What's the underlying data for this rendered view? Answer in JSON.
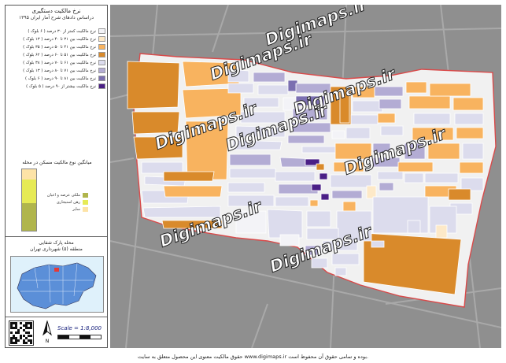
{
  "panel": {
    "title": "نرخ مالکیت دستگیری",
    "subtitle": "دراساس دادهای شرح آمار ایران ۱۳۹۵",
    "legend": [
      {
        "label": "نرخ مالکیت کمتر از ۳۰ درصد ( ۶ بلوک )",
        "color": "#f3f3f7"
      },
      {
        "label": "نرخ مالکیت بین ۳۱ تا ۴۰ درصد ( ۱۳ بلوک )",
        "color": "#fde9c8"
      },
      {
        "label": "نرخ مالکیت بین ۴۱ تا ۵۰ درصد ( ۳۵ بلوک )",
        "color": "#f8b35f"
      },
      {
        "label": "نرخ مالکیت بین ۵۱ تا ۶۰ درصد ( ۶۲ بلوک )",
        "color": "#d98a2b"
      },
      {
        "label": "نرخ مالکیت بین ۶۱ تا ۷۰ درصد ( ۳۸ بلوک )",
        "color": "#dcdced"
      },
      {
        "label": "نرخ مالکیت بین ۷۱ تا ۸۰ درصد ( ۱۳ بلوک )",
        "color": "#b3acd4"
      },
      {
        "label": "نرخ مالکیت بین ۸۱ تا ۹۰ درصد ( ۶ بلوک )",
        "color": "#7b6fb0"
      },
      {
        "label": "نرخ مالکیت بیشتر از ۹۰ درصد ( ۵ بلوک )",
        "color": "#4a1f86"
      }
    ],
    "chart_title": "میانگین نوع مالکیت مسکن در محله",
    "chart_legend": [
      {
        "label": "ملکی عرصه و اعیان",
        "color": "#b0b54c"
      },
      {
        "label": "رهن استیجاری",
        "color": "#e6ea55"
      },
      {
        "label": "سایر",
        "color": "#fde3a7"
      }
    ],
    "location_title": "محله پارک شفایی",
    "location_subtitle": "منطقه (۵) شهرداری تهران",
    "scale": "Scale = 1:8,000",
    "north": "N"
  },
  "chart_data": {
    "type": "bar",
    "categories": [
      "ملکی عرصه و اعیان",
      "رهن استیجاری",
      "سایر"
    ],
    "values": [
      45,
      38,
      17
    ],
    "title": "میانگین نوع مالکیت مسکن در محله"
  },
  "map": {
    "watermarks": [
      "Digimaps.ir",
      "Digimaps.ir",
      "Digimaps.ir",
      "Digimaps.ir",
      "Digimaps.ir",
      "Digimaps.ir",
      "Digimaps.ir",
      "Digimaps.ir"
    ]
  },
  "footer": {
    "text": "حقوق مالکیت معنوی این محصول متعلق به سایت www.digimaps.ir بوده و تمامی حقوق آن محفوظ است.",
    "corner": "Digimaps.ir"
  }
}
